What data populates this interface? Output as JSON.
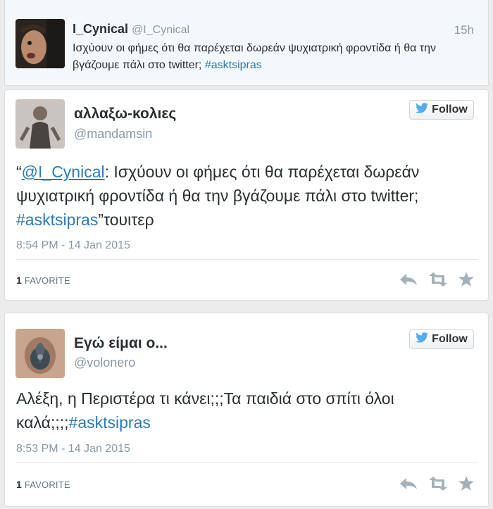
{
  "quoted": {
    "name": "I_Cynical",
    "handle": "@I_Cynical",
    "time": "15h",
    "text_plain": "Ισχύουν οι φήμες ότι θα παρέχεται δωρεάν ψυχιατρική φροντίδα ή θα την βγάζουμε πάλι στο twitter; ",
    "hashtag": "#asktsipras"
  },
  "tweets": [
    {
      "name": "αλλαξω-κολιες",
      "handle": "@mandamsin",
      "follow_label": "Follow",
      "open_quote": "“",
      "mention": "@I_Cynical",
      "text": ": Ισχύουν οι φήμες ότι θα παρέχεται δωρεάν ψυχιατρική φροντίδα ή θα την βγάζουμε πάλι στο twitter; ",
      "hashtag": "#asktsipras",
      "suffix": "”τουιτερ",
      "date": "8:54 PM - 14 Jan 2015",
      "fav_count": "1",
      "fav_label": "FAVORITE"
    },
    {
      "name": "Εγώ είμαι ο...",
      "handle": "@volonero",
      "follow_label": "Follow",
      "text": "Αλέξη, η Περιστέρα τι κάνει;;;Τα παιδιά στο σπίτι όλοι καλά;;;;",
      "hashtag": "#asktsipras",
      "date": "8:53 PM - 14 Jan 2015",
      "fav_count": "1",
      "fav_label": "FAVORITE"
    }
  ],
  "colors": {
    "link": "#2b7bb9",
    "muted": "#8899a6",
    "twitter_bird": "#55acee"
  },
  "icons": [
    "reply-icon",
    "retweet-icon",
    "favorite-icon",
    "twitter-bird-icon"
  ]
}
